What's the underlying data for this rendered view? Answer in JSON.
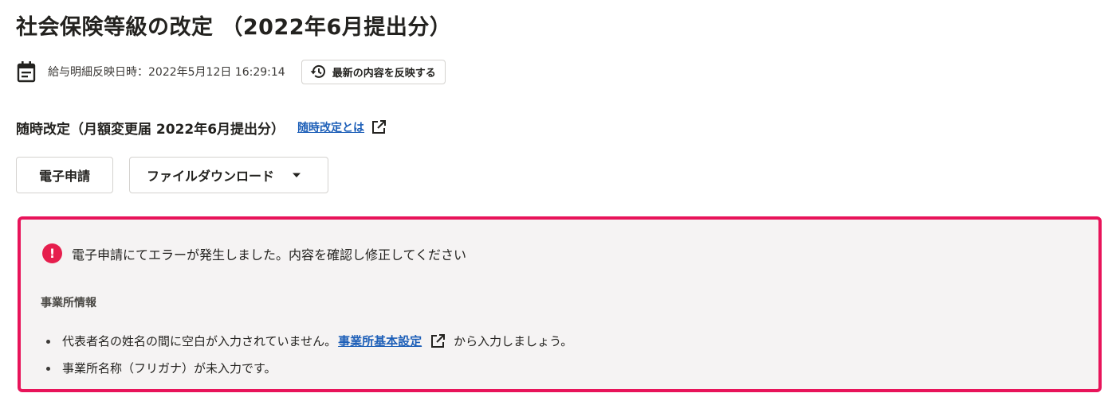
{
  "page": {
    "title": "社会保険等級の改定 （2022年6月提出分）"
  },
  "meta": {
    "label": "給与明細反映日時：2022年5月12日 16:29:14",
    "refresh_button": "最新の内容を反映する",
    "icons": [
      "calendar-icon",
      "history-icon"
    ]
  },
  "section": {
    "title": "随時改定（月額変更届 2022年6月提出分）",
    "help_link": "随時改定とは"
  },
  "actions": {
    "e_apply": "電子申請",
    "file_download": "ファイルダウンロード"
  },
  "error": {
    "message": "電子申請にてエラーが発生しました。内容を確認し修正してください",
    "section_label": "事業所情報",
    "items": [
      {
        "before": "代表者名の姓名の間に空白が入力されていません。",
        "link": "事業所基本設定",
        "after": "から入力しましょう。"
      },
      {
        "text": "事業所名称（フリガナ）が未入力です。"
      }
    ]
  },
  "colors": {
    "error_border": "#e8145a",
    "error_icon": "#e61e4d",
    "link": "#1d5fb8",
    "error_bg": "#f5f3f3"
  }
}
